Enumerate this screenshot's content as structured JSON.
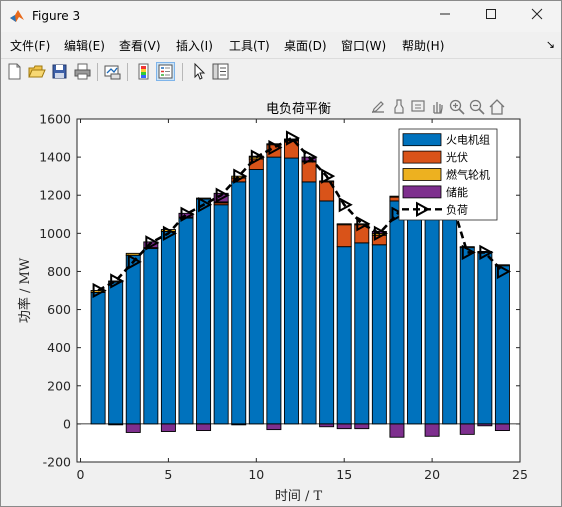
{
  "window": {
    "title": "Figure 3"
  },
  "menu": [
    {
      "label": "文件(F)",
      "key": "file"
    },
    {
      "label": "编辑(E)",
      "key": "edit"
    },
    {
      "label": "查看(V)",
      "key": "view"
    },
    {
      "label": "插入(I)",
      "key": "insert"
    },
    {
      "label": "工具(T)",
      "key": "tools"
    },
    {
      "label": "桌面(D)",
      "key": "desktop"
    },
    {
      "label": "窗口(W)",
      "key": "window"
    },
    {
      "label": "帮助(H)",
      "key": "help"
    }
  ],
  "colors": {
    "thermal": "#0072BD",
    "pv": "#D95319",
    "gas": "#EDB120",
    "storage": "#7E2F8E",
    "load": "#000000"
  },
  "chart_data": {
    "type": "bar",
    "title": "电负荷平衡",
    "xlabel": "时间 / T",
    "ylabel": "功率 / MW",
    "xlim": [
      -0.2,
      25
    ],
    "ylim": [
      -200,
      1600
    ],
    "xticks": [
      0,
      5,
      10,
      15,
      20,
      25
    ],
    "yticks": [
      -200,
      0,
      200,
      400,
      600,
      800,
      1000,
      1200,
      1400,
      1600
    ],
    "grid": false,
    "legend_position": "top-right",
    "stacked": true,
    "x": [
      1,
      2,
      3,
      4,
      5,
      6,
      7,
      8,
      9,
      10,
      11,
      12,
      13,
      14,
      15,
      16,
      17,
      18,
      19,
      20,
      21,
      22,
      23,
      24
    ],
    "series": [
      {
        "name": "火电机组",
        "key": "thermal",
        "kind": "bar",
        "values": [
          690,
          745,
          885,
          920,
          1010,
          1080,
          1180,
          1150,
          1270,
          1335,
          1400,
          1395,
          1270,
          1170,
          930,
          950,
          940,
          1170,
          1130,
          1265,
          1160,
          925,
          900,
          830
        ]
      },
      {
        "name": "光伏",
        "key": "pv",
        "kind": "bar",
        "values": [
          0,
          0,
          0,
          0,
          0,
          0,
          0,
          10,
          20,
          55,
          65,
          90,
          105,
          100,
          115,
          95,
          50,
          20,
          0,
          0,
          0,
          0,
          0,
          0
        ]
      },
      {
        "name": "燃气轮机",
        "key": "gas",
        "kind": "bar",
        "values": [
          10,
          5,
          10,
          5,
          10,
          5,
          5,
          5,
          10,
          10,
          5,
          5,
          5,
          5,
          5,
          5,
          10,
          5,
          5,
          5,
          5,
          5,
          5,
          5
        ]
      },
      {
        "name": "储能",
        "key": "storage",
        "kind": "bar",
        "values": [
          0,
          -5,
          -45,
          30,
          -40,
          20,
          -35,
          45,
          -5,
          5,
          -30,
          5,
          20,
          -15,
          -25,
          -25,
          10,
          -70,
          60,
          -65,
          55,
          -55,
          -10,
          -35
        ]
      },
      {
        "name": "负荷",
        "key": "load",
        "kind": "line",
        "values": [
          700,
          750,
          850,
          950,
          1000,
          1100,
          1150,
          1200,
          1300,
          1400,
          1450,
          1500,
          1400,
          1300,
          1150,
          1050,
          1000,
          1100,
          1200,
          1200,
          1200,
          900,
          900,
          800
        ]
      }
    ]
  }
}
